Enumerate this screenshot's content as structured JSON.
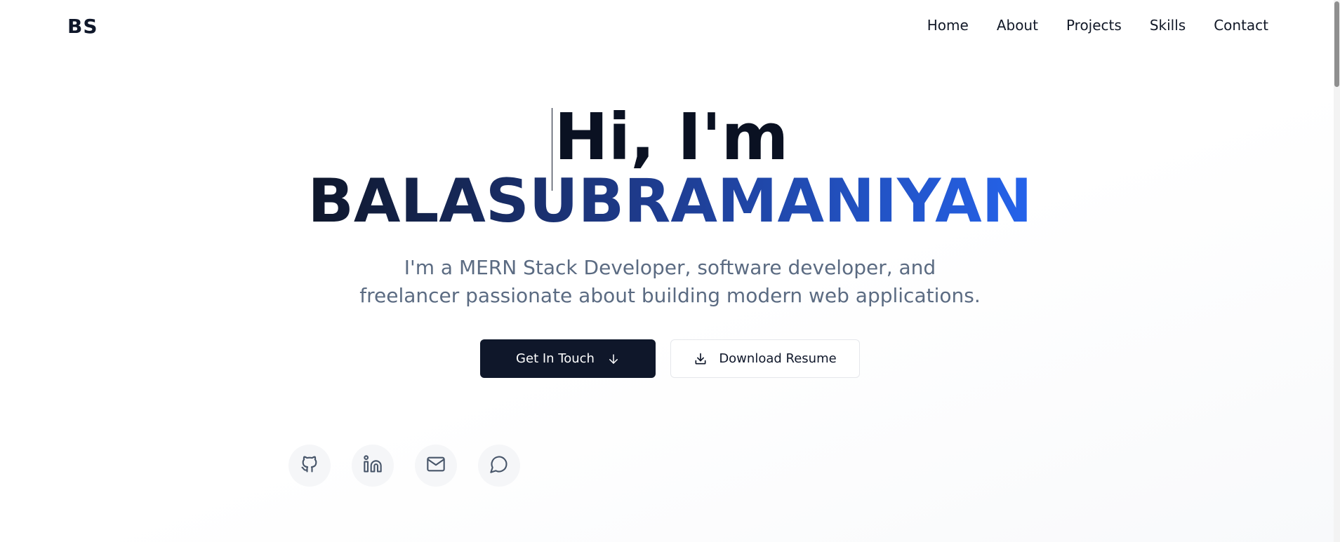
{
  "nav": {
    "logo": "BS",
    "links": [
      "Home",
      "About",
      "Projects",
      "Skills",
      "Contact"
    ]
  },
  "hero": {
    "greeting": "Hi, I'm",
    "name": "BALASUBRAMANIYAN",
    "tagline_line1": "I'm a MERN Stack Developer, software developer, and",
    "tagline_line2": "freelancer passionate about building modern web applications.",
    "primary_button": "Get In Touch",
    "secondary_button": "Download Resume"
  },
  "socials": [
    "github-icon",
    "linkedin-icon",
    "mail-icon",
    "chat-icon"
  ],
  "colors": {
    "primary": "#0f172a",
    "accent": "#2563eb",
    "muted_text": "#5b6b82"
  }
}
